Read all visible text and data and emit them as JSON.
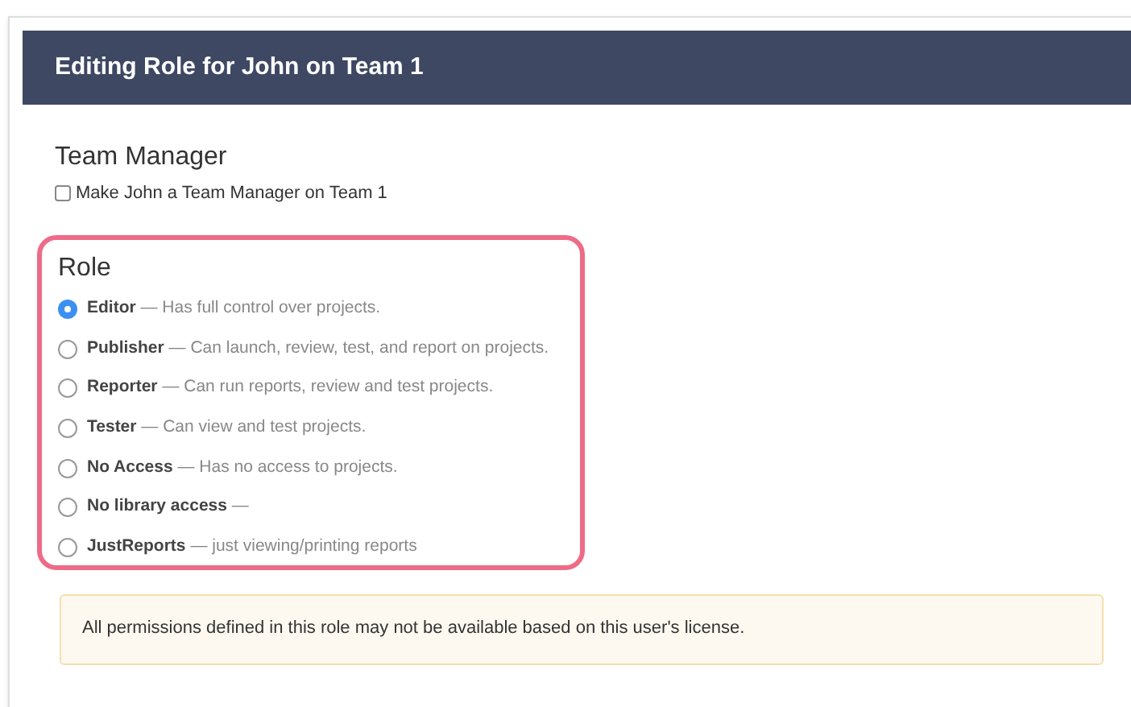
{
  "header": {
    "title": "Editing Role for John on Team 1"
  },
  "team_manager": {
    "heading": "Team Manager",
    "checkbox": {
      "label": "Make John a Team Manager on Team 1",
      "checked": false
    }
  },
  "role": {
    "heading": "Role",
    "options": [
      {
        "name": "Editor",
        "description": "— Has full control over projects.",
        "selected": true
      },
      {
        "name": "Publisher",
        "description": "— Can launch, review, test, and report on projects.",
        "selected": false
      },
      {
        "name": "Reporter",
        "description": "— Can run reports, review and test projects.",
        "selected": false
      },
      {
        "name": "Tester",
        "description": "— Can view and test projects.",
        "selected": false
      },
      {
        "name": "No Access",
        "description": "— Has no access to projects.",
        "selected": false
      },
      {
        "name": "No library access",
        "description": "—",
        "selected": false
      },
      {
        "name": "JustReports",
        "description": "— just viewing/printing reports",
        "selected": false
      }
    ]
  },
  "notice": "All permissions defined in this role may not be available based on this user's license."
}
